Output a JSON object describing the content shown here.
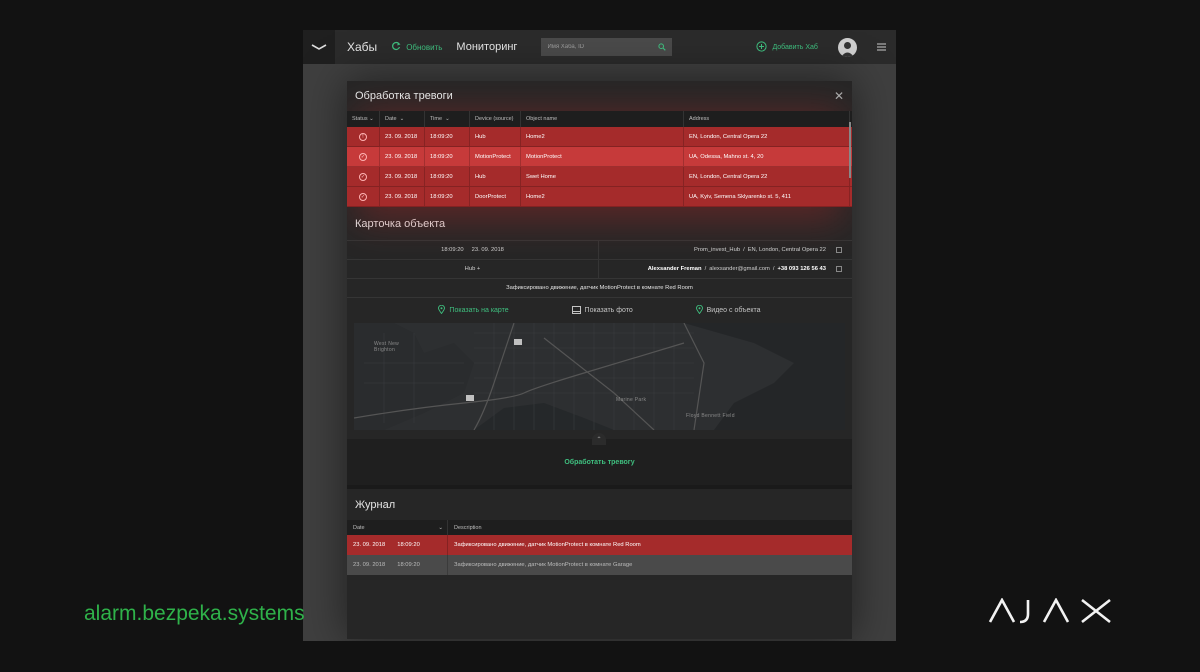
{
  "topbar": {
    "hubs_title": "Хабы",
    "refresh_label": "Обновить",
    "monitoring": "Мониторинг",
    "search_placeholder": "Имя Хаба, ID",
    "add_hub": "Добавить Хаб"
  },
  "alarm": {
    "title": "Обработка тревоги",
    "columns": [
      "Status",
      "Date",
      "Time",
      "Device (source)",
      "Object name",
      "Address"
    ],
    "rows": [
      {
        "date": "23. 09. 2018",
        "time": "18:09:20",
        "device": "Hub",
        "object": "Home2",
        "address": "EN, London, Central Opera 22"
      },
      {
        "date": "23. 09. 2018",
        "time": "18:09:20",
        "device": "MotionProtect",
        "object": "MotionProtect",
        "address": "UA, Odessa, Mahno st. 4, 20"
      },
      {
        "date": "23. 09. 2018",
        "time": "18:09:20",
        "device": "Hub",
        "object": "Swet Home",
        "address": "EN, London, Central Opera 22"
      },
      {
        "date": "23. 09. 2018",
        "time": "18:09:20",
        "device": "DoorProtect",
        "object": "Home2",
        "address": "UA, Kyiv, Semena Sklyarenko st. 5, 411"
      }
    ]
  },
  "card": {
    "title": "Карточка объекта",
    "time": "18:09:20",
    "date": "23. 09. 2018",
    "hub_name": "Prom_invest_Hub",
    "hub_address": "EN, London, Central Opera 22",
    "hub_label": "Hub +",
    "contact_name": "Alexsander Freman",
    "contact_email": "alexsander@gmail.com",
    "contact_phone": "+38 093 126 56 43",
    "message": "Зафиксировано движение, датчик MotionProtect в комнате Red Room",
    "show_map": "Показать на карте",
    "show_photo": "Показать фото",
    "video": "Видео с объекта",
    "map_labels": [
      "West New Brighton",
      "Marine Park",
      "Floyd Bennett Field"
    ],
    "process_button": "Обработать тревогу"
  },
  "journal": {
    "title": "Журнал",
    "columns": [
      "Date",
      "Description"
    ],
    "rows": [
      {
        "date": "23. 09. 2018",
        "time": "18:09:20",
        "desc": "Зафиксировано движение, датчик MotionProtect в комнате Red Room"
      },
      {
        "date": "23. 09. 2018",
        "time": "18:09:20",
        "desc": "Зафиксировано движение, датчик MotionProtect в комнате Garage"
      }
    ]
  },
  "footer": {
    "website": "alarm.bezpeka.systems",
    "brand": "AJAX"
  },
  "colors": {
    "accent_green": "#3fbf7f",
    "alarm_red": "#c63a3a",
    "alarm_dark_red": "#a52b2b",
    "site_green": "#2fb24a"
  }
}
